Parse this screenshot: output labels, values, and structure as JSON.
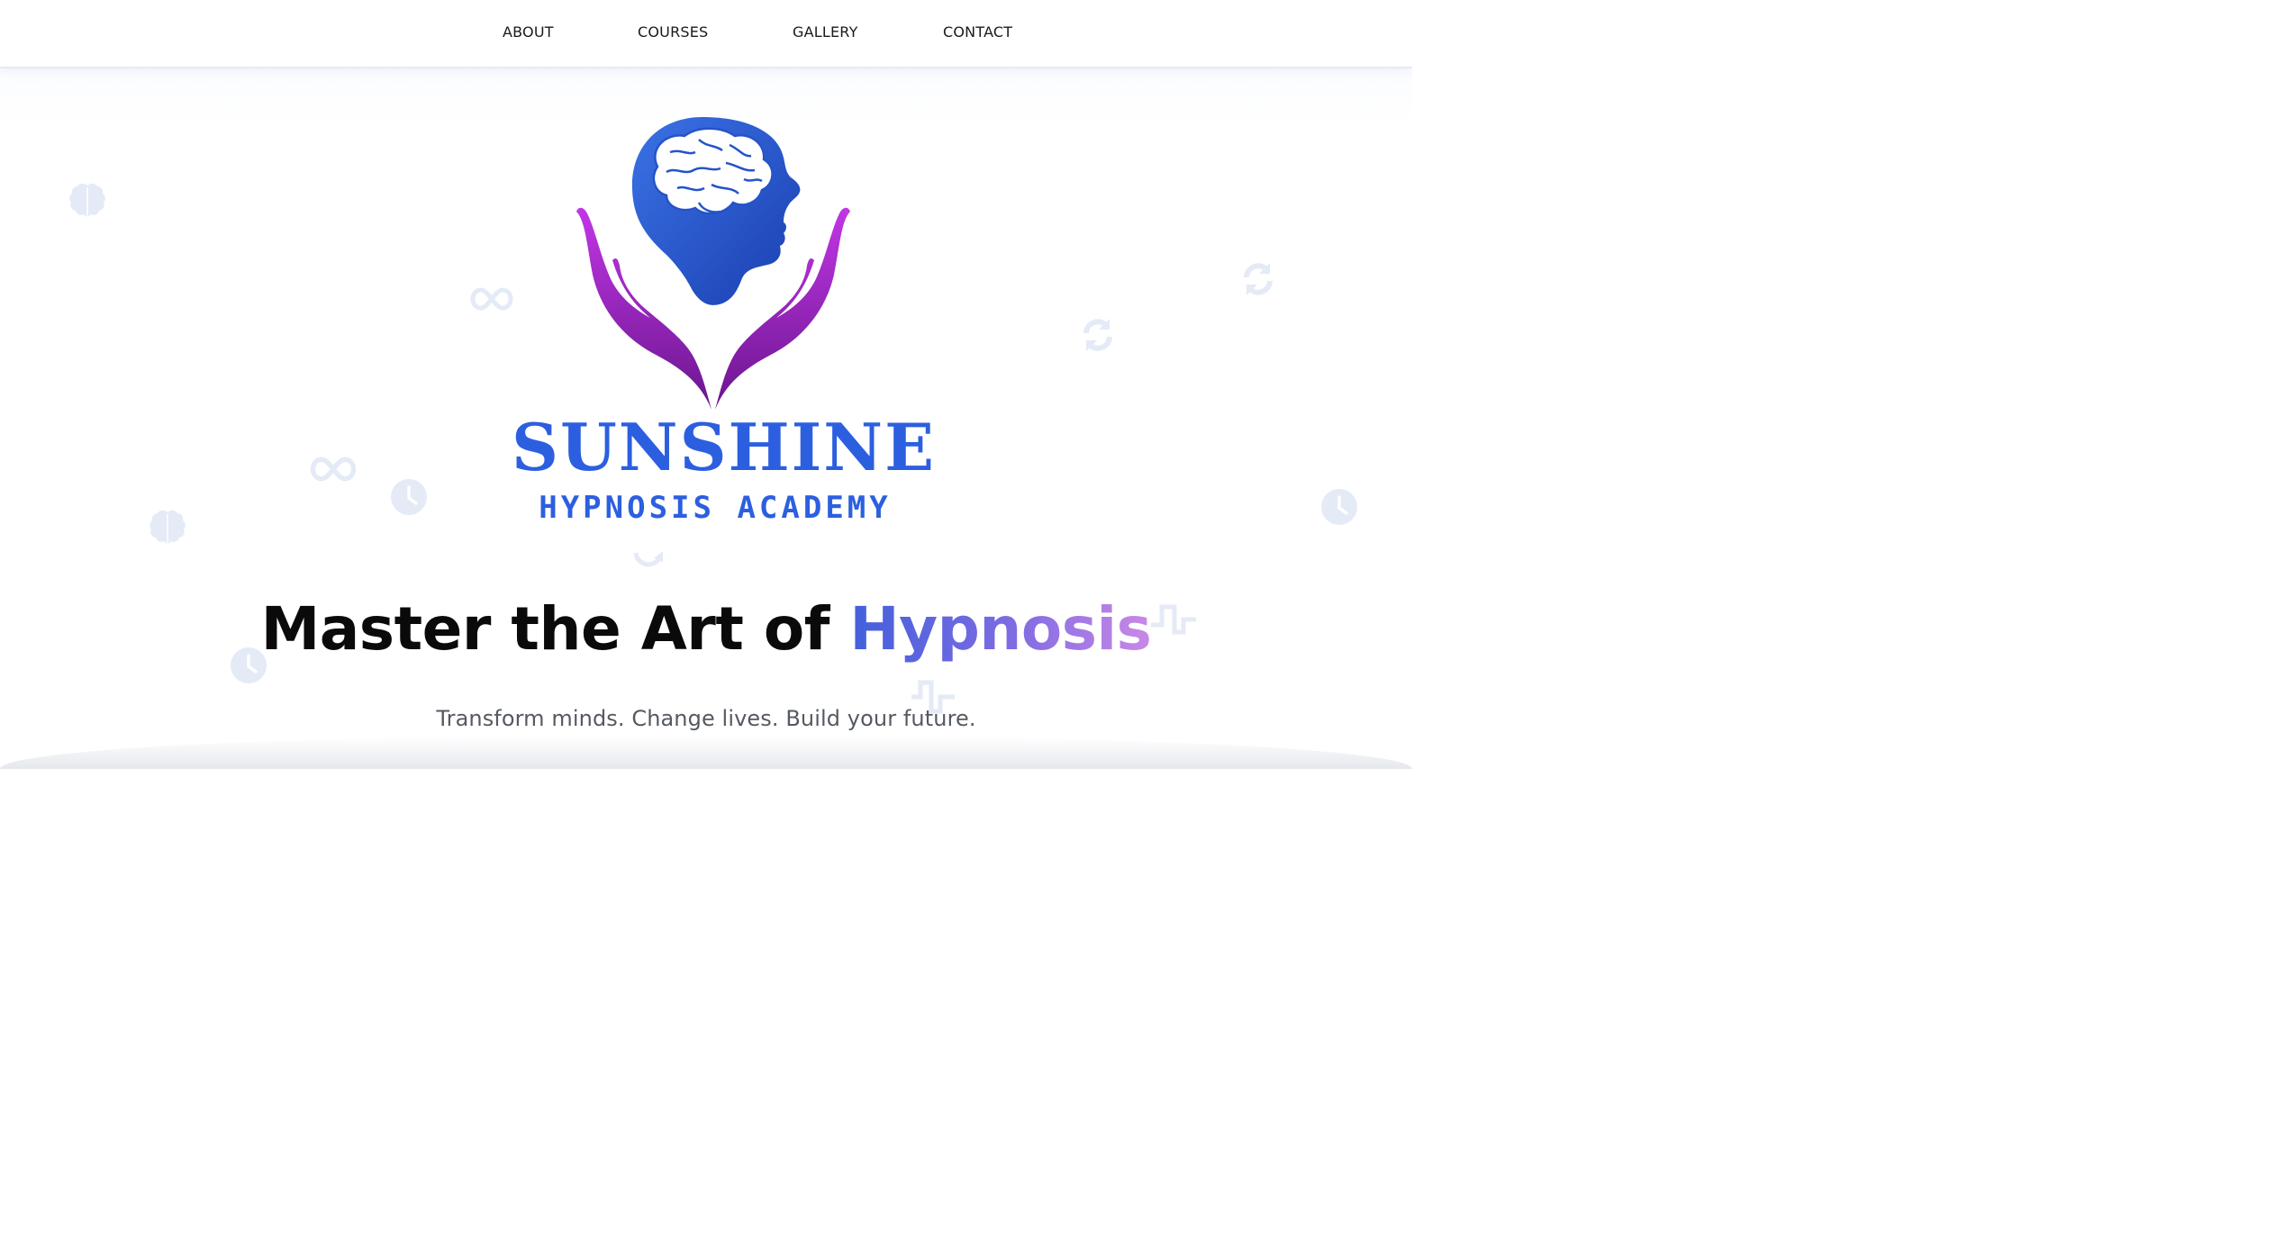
{
  "nav": {
    "items": [
      {
        "label": "ABOUT"
      },
      {
        "label": "COURSES"
      },
      {
        "label": "GALLERY"
      },
      {
        "label": "CONTACT"
      }
    ]
  },
  "logo": {
    "brand_name": "SUNSHINE",
    "brand_subtitle": "HYPNOSIS ACADEMY",
    "icon": "head-brain-hands-icon"
  },
  "hero": {
    "title_prefix": "Master the Art of ",
    "title_accent": "Hypnosis",
    "subtitle": "Transform minds. Change lives. Build your future."
  },
  "decorative_icons": [
    "brain-icon",
    "infinity-icon",
    "sync-icon",
    "clock-icon",
    "pulse-icon"
  ],
  "colors": {
    "brand_blue": "#2f5fe0",
    "brand_purple": "#8e2bc0",
    "accent_gradient_start": "#4260dc",
    "accent_gradient_end": "#cb88e6",
    "decor_icon": "#e4eaf6"
  }
}
